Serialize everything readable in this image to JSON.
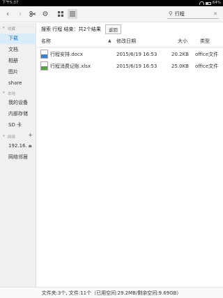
{
  "status": {
    "time": "下午5:37",
    "battery": "64%"
  },
  "toolbar": {
    "back_icon": "chevron-left-icon",
    "forward_icon": "chevron-right-icon",
    "search_value": "行程"
  },
  "sidebar": {
    "favorites_header": "收藏",
    "favorites": [
      "下载",
      "文档",
      "相册",
      "图片",
      "share"
    ],
    "local_header": "本地",
    "local": [
      "我的设备",
      "内部存储",
      "SD 卡"
    ],
    "network_header": "网络",
    "network": [
      "192.16.",
      "网络邻居"
    ]
  },
  "results": {
    "summary": "搜索 行程 结束：共2个结果",
    "back_label": "返回"
  },
  "columns": {
    "name": "名称",
    "modified": "修改日期",
    "size": "大小",
    "type": "类型"
  },
  "files": [
    {
      "name": "行程安排.docx",
      "modified": "2015/6/19 16:53",
      "size": "20.2KB",
      "type": "office文件",
      "icon": "word-document-icon",
      "color": "#3b7fd1"
    },
    {
      "name": "行程消费记账.xlsx",
      "modified": "2015/6/19 16:53",
      "size": "25.0KB",
      "type": "office文件",
      "icon": "excel-spreadsheet-icon",
      "color": "#5aa343"
    }
  ],
  "footer": {
    "text": "文件夹:3个, 文件:11个（已用空间:29.2MB/剩余空间:9.69GB）"
  }
}
